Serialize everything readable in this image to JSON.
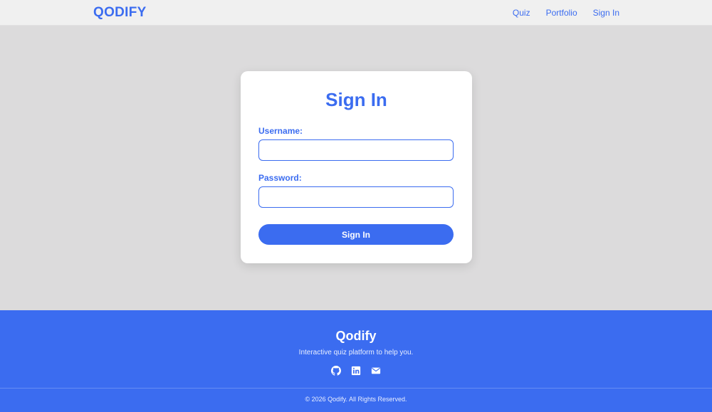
{
  "header": {
    "brand": "QODIFY",
    "nav": [
      {
        "label": "Quiz"
      },
      {
        "label": "Portfolio"
      },
      {
        "label": "Sign In"
      }
    ]
  },
  "signin": {
    "title": "Sign In",
    "username_label": "Username:",
    "username_value": "",
    "password_label": "Password:",
    "password_value": "",
    "submit_label": "Sign In"
  },
  "footer": {
    "title": "Qodify",
    "tagline": "Interactive quiz platform to help you.",
    "icons": [
      "github-icon",
      "linkedin-icon",
      "email-icon"
    ],
    "copyright": "© 2026 Qodify. All Rights Reserved."
  },
  "colors": {
    "accent": "#3b6cf0",
    "navbar_bg": "#f0f0f0",
    "page_bg": "#dcdbdc",
    "card_bg": "#ffffff"
  }
}
